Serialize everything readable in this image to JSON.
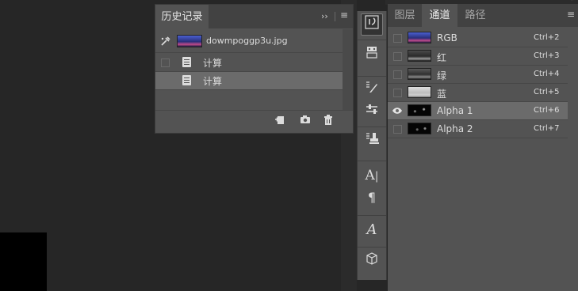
{
  "history": {
    "tab_label": "历史记录",
    "expand_icon": "double-chevron-right-icon",
    "menu_icon": "hamburger-menu-icon",
    "snapshot": {
      "label": "dowmpoggp3u.jpg"
    },
    "items": [
      {
        "label": "计算"
      },
      {
        "label": "计算"
      }
    ],
    "footer_icons": [
      "new-document-from-state-icon",
      "camera-snapshot-icon",
      "trash-icon"
    ]
  },
  "tools": [
    "history-brush-icon",
    "3d-material-icon",
    "brush-settings-icon",
    "adjustments-icon",
    "clone-stamp-icon",
    "character-type-icon",
    "paragraph-icon",
    "glyphs-icon",
    "3d-cube-icon"
  ],
  "channels": {
    "tabs": [
      {
        "label": "图层",
        "active": false
      },
      {
        "label": "通道",
        "active": true
      },
      {
        "label": "路径",
        "active": false
      }
    ],
    "rows": [
      {
        "name": "RGB",
        "shortcut": "Ctrl+2",
        "visible": false,
        "selected": false
      },
      {
        "name": "红",
        "shortcut": "Ctrl+3",
        "visible": false,
        "selected": false
      },
      {
        "name": "绿",
        "shortcut": "Ctrl+4",
        "visible": false,
        "selected": false
      },
      {
        "name": "蓝",
        "shortcut": "Ctrl+5",
        "visible": false,
        "selected": false
      },
      {
        "name": "Alpha 1",
        "shortcut": "Ctrl+6",
        "visible": true,
        "selected": true
      },
      {
        "name": "Alpha 2",
        "shortcut": "Ctrl+7",
        "visible": false,
        "selected": false
      }
    ]
  },
  "colors": {
    "panel_bg": "#535353",
    "tabbar_bg": "#424242",
    "workspace_bg": "#262626",
    "selected_row": "#6b6b6b"
  }
}
